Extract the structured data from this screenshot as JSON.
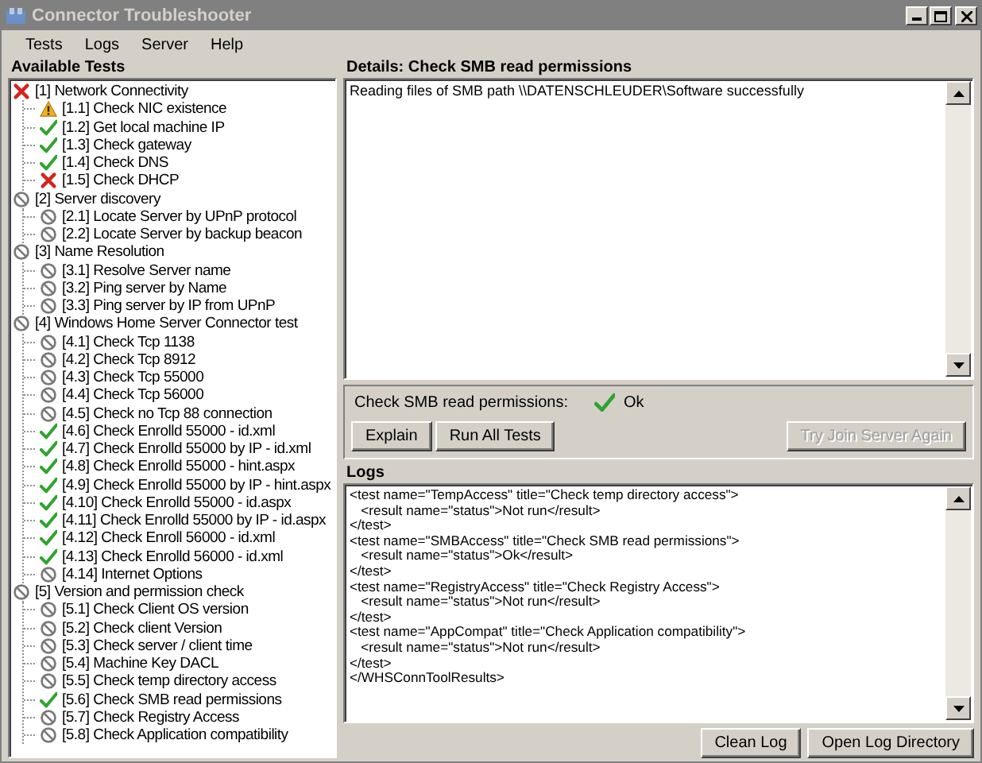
{
  "window": {
    "title": "Connector Troubleshooter"
  },
  "menu": [
    "Tests",
    "Logs",
    "Server",
    "Help"
  ],
  "tests_panel": {
    "title": "Available Tests",
    "tree": [
      {
        "label": "[1] Network Connectivity",
        "kind": "fail",
        "children": [
          {
            "label": "[1.1] Check NIC existence",
            "kind": "warn"
          },
          {
            "label": "[1.2] Get local machine IP",
            "kind": "ok"
          },
          {
            "label": "[1.3] Check gateway",
            "kind": "ok"
          },
          {
            "label": "[1.4] Check DNS",
            "kind": "ok"
          },
          {
            "label": "[1.5] Check DHCP",
            "kind": "fail"
          }
        ]
      },
      {
        "label": "[2] Server discovery",
        "kind": "skip",
        "children": [
          {
            "label": "[2.1] Locate Server by UPnP protocol",
            "kind": "skip"
          },
          {
            "label": "[2.2] Locate Server by backup beacon",
            "kind": "skip"
          }
        ]
      },
      {
        "label": "[3] Name Resolution",
        "kind": "skip",
        "children": [
          {
            "label": "[3.1] Resolve Server name",
            "kind": "skip"
          },
          {
            "label": "[3.2] Ping server by Name",
            "kind": "skip"
          },
          {
            "label": "[3.3] Ping server by IP from UPnP",
            "kind": "skip"
          }
        ]
      },
      {
        "label": "[4] Windows Home Server Connector test",
        "kind": "skip",
        "children": [
          {
            "label": "[4.1] Check Tcp 1138",
            "kind": "skip"
          },
          {
            "label": "[4.2] Check Tcp 8912",
            "kind": "skip"
          },
          {
            "label": "[4.3] Check Tcp 55000",
            "kind": "skip"
          },
          {
            "label": "[4.4] Check Tcp 56000",
            "kind": "skip"
          },
          {
            "label": "[4.5] Check no Tcp 88 connection",
            "kind": "skip"
          },
          {
            "label": "[4.6] Check Enrolld 55000 - id.xml",
            "kind": "ok"
          },
          {
            "label": "[4.7] Check Enrolld 55000 by IP - id.xml",
            "kind": "ok"
          },
          {
            "label": "[4.8] Check Enrolld 55000 - hint.aspx",
            "kind": "ok"
          },
          {
            "label": "[4.9] Check Enrolld 55000 by IP - hint.aspx",
            "kind": "ok"
          },
          {
            "label": "[4.10] Check Enrolld 55000 - id.aspx",
            "kind": "ok"
          },
          {
            "label": "[4.11] Check Enrolld 55000 by IP - id.aspx",
            "kind": "ok"
          },
          {
            "label": "[4.12] Check Enroll 56000 - id.xml",
            "kind": "ok"
          },
          {
            "label": "[4.13] Check Enrolld 56000 - id.xml",
            "kind": "ok"
          },
          {
            "label": "[4.14] Internet Options",
            "kind": "skip"
          }
        ]
      },
      {
        "label": "[5] Version and permission check",
        "kind": "skip",
        "children": [
          {
            "label": "[5.1] Check Client OS version",
            "kind": "skip"
          },
          {
            "label": "[5.2] Check client Version",
            "kind": "skip"
          },
          {
            "label": "[5.3] Check server / client time",
            "kind": "skip"
          },
          {
            "label": "[5.4] Machine Key DACL",
            "kind": "skip"
          },
          {
            "label": "[5.5] Check temp directory access",
            "kind": "skip"
          },
          {
            "label": "[5.6] Check SMB read permissions",
            "kind": "ok"
          },
          {
            "label": "[5.7] Check Registry Access",
            "kind": "skip"
          },
          {
            "label": "[5.8] Check Application compatibility",
            "kind": "skip"
          }
        ]
      }
    ]
  },
  "details": {
    "title": "Details: Check SMB read permissions",
    "text": "Reading files of SMB path \\\\DATENSCHLEUDER\\Software successfully"
  },
  "result": {
    "label": "Check SMB read permissions:",
    "kind": "ok",
    "text": "Ok"
  },
  "buttons": [
    {
      "label": "Explain",
      "disabled": false
    },
    {
      "label": "Run All Tests",
      "disabled": false
    },
    {
      "label": "Try Join Server Again",
      "disabled": true
    }
  ],
  "logs": {
    "title": "Logs",
    "lines": [
      "<test name=\"TempAccess\" title=\"Check temp directory access\">",
      "   <result name=\"status\">Not run</result>",
      "</test>",
      "<test name=\"SMBAccess\" title=\"Check SMB read permissions\">",
      "   <result name=\"status\">Ok</result>",
      "</test>",
      "<test name=\"RegistryAccess\" title=\"Check Registry Access\">",
      "   <result name=\"status\">Not run</result>",
      "</test>",
      "<test name=\"AppCompat\" title=\"Check Application compatibility\">",
      "   <result name=\"status\">Not run</result>",
      "</test>",
      "</WHSConnToolResults>"
    ]
  },
  "log_buttons": [
    {
      "label": "Clean Log",
      "disabled": false
    },
    {
      "label": "Open Log Directory",
      "disabled": false
    }
  ]
}
